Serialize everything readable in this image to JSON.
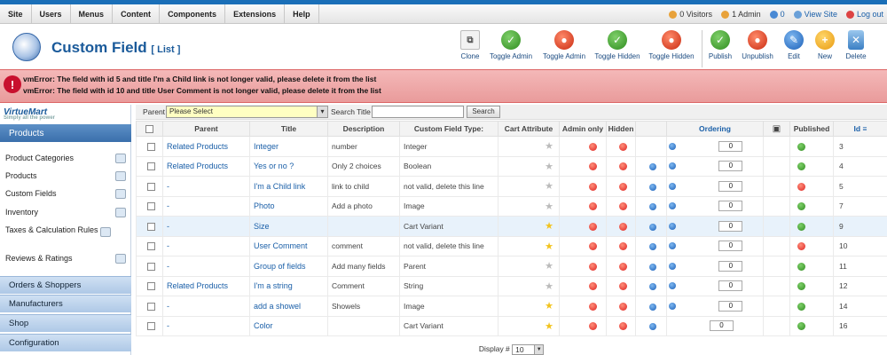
{
  "menu": [
    "Site",
    "Users",
    "Menus",
    "Content",
    "Components",
    "Extensions",
    "Help"
  ],
  "status": {
    "visitors": "0 Visitors",
    "admins": "1 Admin",
    "messages": "0",
    "view_site": "View Site",
    "logout": "Log out"
  },
  "page": {
    "title": "Custom Field",
    "subtitle": "[ List ]"
  },
  "toolbar": [
    "Clone",
    "Toggle Admin",
    "Toggle Admin",
    "Toggle Hidden",
    "Toggle Hidden",
    "Publish",
    "Unpublish",
    "Edit",
    "New",
    "Delete"
  ],
  "errors": [
    "vmError: The field with id 5 and title I'm a Child link is not longer valid, please delete it from the list",
    "vmError: The field with id 10 and title User Comment is not longer valid, please delete it from the list"
  ],
  "sidebar": {
    "logo": "VirtueMart",
    "logo_tag": "Simply all the power",
    "active": "Products",
    "items": [
      "Product Categories",
      "Products",
      "Custom Fields",
      "Inventory",
      "Taxes & Calculation Rules",
      "Reviews & Ratings"
    ],
    "sections": [
      "Orders & Shoppers",
      "Manufacturers",
      "Shop",
      "Configuration"
    ]
  },
  "filter": {
    "parent_label": "Parent",
    "parent_value": "Please Select",
    "search_label": "Search Title",
    "search_button": "Search"
  },
  "table": {
    "headers": [
      "Parent",
      "Title",
      "Description",
      "Custom Field Type:",
      "Cart Attribute",
      "Admin only",
      "Hidden",
      "Ordering",
      "Published",
      "Id"
    ],
    "rows": [
      {
        "parent": "Related Products",
        "title": "Integer",
        "desc": "number",
        "type": "Integer",
        "star": "grey",
        "ord": "0",
        "pub": "ok",
        "id": "3",
        "up": false,
        "down": true
      },
      {
        "parent": "Related Products",
        "title": "Yes or no ?",
        "desc": "Only 2 choices",
        "type": "Boolean",
        "star": "grey",
        "ord": "0",
        "pub": "ok",
        "id": "4",
        "up": true,
        "down": true
      },
      {
        "parent": "-",
        "title": "I'm a Child link",
        "desc": "link to child",
        "type": "not valid, delete this line",
        "star": "grey",
        "ord": "0",
        "pub": "no",
        "id": "5",
        "up": true,
        "down": true
      },
      {
        "parent": "-",
        "title": "Photo",
        "desc": "Add a photo",
        "type": "Image",
        "star": "grey",
        "ord": "0",
        "pub": "ok",
        "id": "7",
        "up": true,
        "down": true
      },
      {
        "parent": "-",
        "title": "Size",
        "desc": "",
        "type": "Cart Variant",
        "star": "gold",
        "ord": "0",
        "pub": "ok",
        "id": "9",
        "up": true,
        "down": true
      },
      {
        "parent": "-",
        "title": "User Comment",
        "desc": "comment",
        "type": "not valid, delete this line",
        "star": "gold",
        "ord": "0",
        "pub": "no",
        "id": "10",
        "up": true,
        "down": true
      },
      {
        "parent": "-",
        "title": "Group of fields",
        "desc": "Add many fields",
        "type": "Parent",
        "star": "grey",
        "ord": "0",
        "pub": "ok",
        "id": "11",
        "up": true,
        "down": true
      },
      {
        "parent": "Related Products",
        "title": "I'm a string",
        "desc": "Comment",
        "type": "String",
        "star": "grey",
        "ord": "0",
        "pub": "ok",
        "id": "12",
        "up": true,
        "down": true
      },
      {
        "parent": "-",
        "title": "add a showel",
        "desc": "Showels",
        "type": "Image",
        "star": "gold",
        "ord": "0",
        "pub": "ok",
        "id": "14",
        "up": true,
        "down": true
      },
      {
        "parent": "-",
        "title": "Color",
        "desc": "",
        "type": "Cart Variant",
        "star": "gold",
        "ord": "0",
        "pub": "ok",
        "id": "16",
        "up": true,
        "down": false
      }
    ]
  },
  "footer": {
    "display_label": "Display #",
    "display_value": "10"
  }
}
